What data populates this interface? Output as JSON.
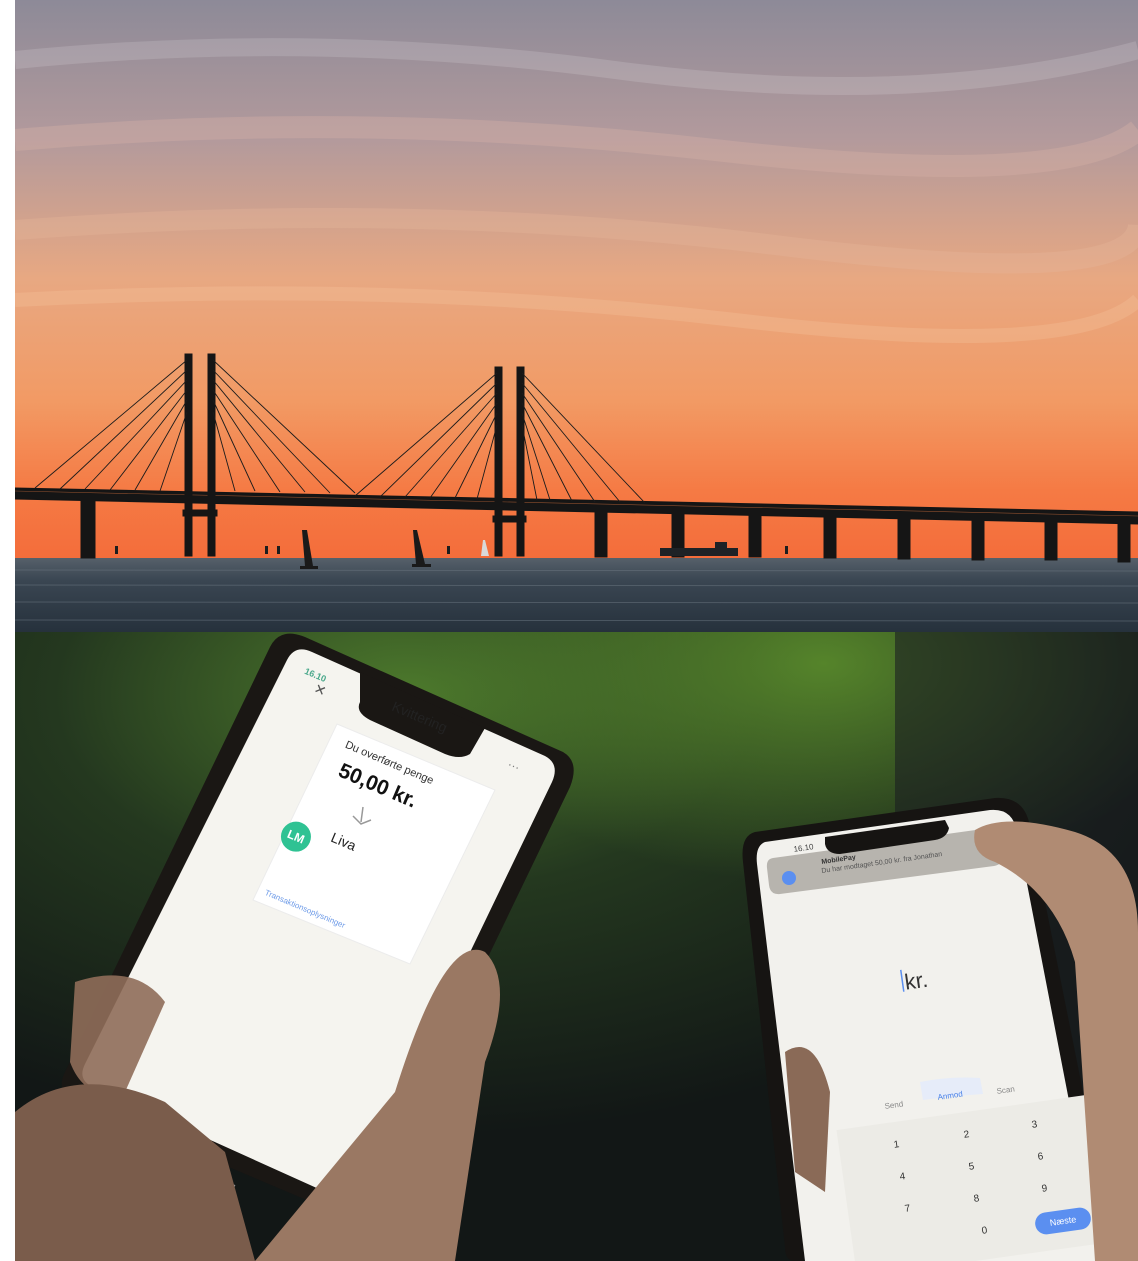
{
  "left_phone": {
    "status_time": "16.10",
    "close_icon": "close-icon",
    "title": "Kvittering",
    "transfer_label": "Du overførte penge",
    "amount": "50,00 kr.",
    "arrow_icon": "arrow-down-icon",
    "avatar_initials": "LM",
    "recipient_name": "Liva",
    "more_icon": "more-dots-icon",
    "link_text": "Transaktionsoplysninger"
  },
  "right_phone": {
    "status_time": "16.10",
    "notification_app": "MobilePay",
    "notification_text": "Du har modtaget 50,00 kr. fra Jonathan",
    "amount_unit": "kr.",
    "actions": {
      "send": "Send",
      "request": "Anmod",
      "scan": "Scan"
    },
    "keys": [
      "1",
      "2",
      "3",
      "4",
      "5",
      "6",
      "7",
      "8",
      "9",
      "0"
    ],
    "next_button": "Næste"
  },
  "colors": {
    "sky_top": "#8f8a97",
    "sky_mid": "#e8a27f",
    "sky_horizon": "#f3743f",
    "sea": "#2c3844",
    "bridge": "#141414",
    "app_green": "#2fc293",
    "app_blue": "#5b8ff0"
  }
}
